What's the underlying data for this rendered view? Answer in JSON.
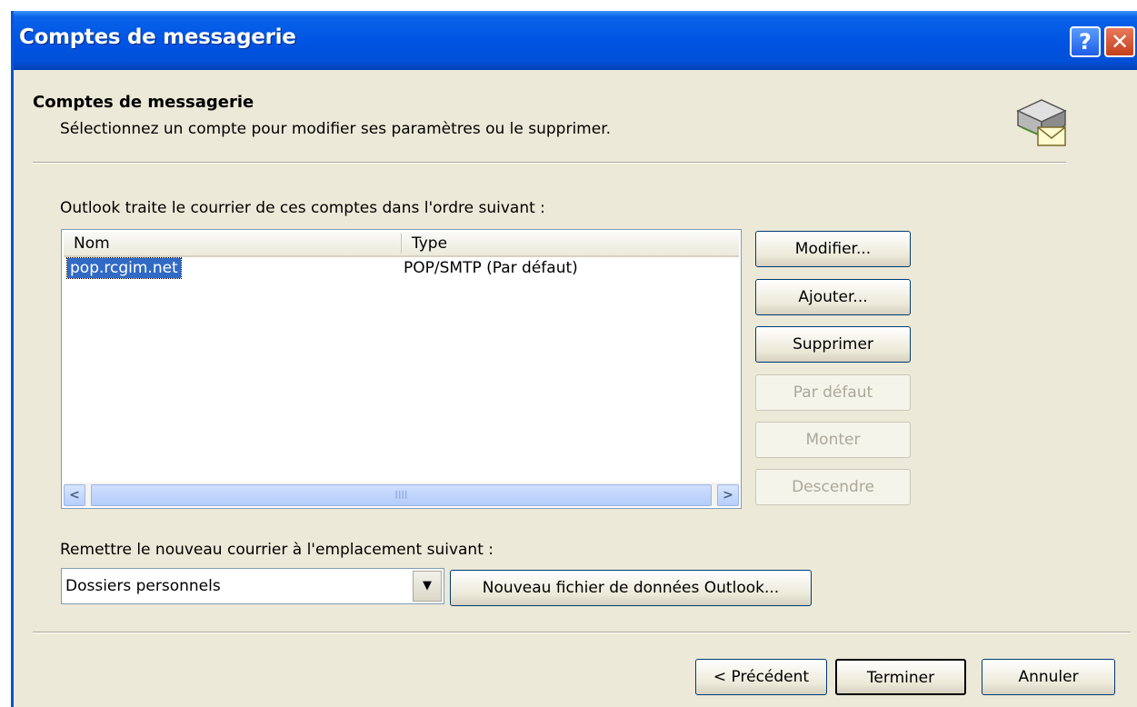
{
  "window": {
    "title": "Comptes de messagerie",
    "help_button": "?",
    "close_button": "✕"
  },
  "header": {
    "heading": "Comptes de messagerie",
    "subheading": "Sélectionnez un compte pour modifier ses paramètres ou le supprimer."
  },
  "accounts": {
    "label": "Outlook traite le courrier de ces comptes dans l'ordre suivant :",
    "columns": [
      "Nom",
      "Type"
    ],
    "rows": [
      {
        "name": "pop.rcgim.net",
        "type": "POP/SMTP (Par défaut)"
      }
    ]
  },
  "side_buttons": {
    "modify": "Modifier...",
    "add": "Ajouter...",
    "remove": "Supprimer",
    "default": "Par défaut",
    "up": "Monter",
    "down": "Descendre"
  },
  "delivery": {
    "label": "Remettre le nouveau courrier à l'emplacement suivant :",
    "selected": "Dossiers personnels",
    "new_file_button": "Nouveau fichier de données Outlook..."
  },
  "footer": {
    "previous": "< Précédent",
    "finish": "Terminer",
    "cancel": "Annuler"
  },
  "colors": {
    "titlebar": "#0054e3",
    "selection": "#316ac5",
    "dialog_bg": "#ece9d8"
  }
}
